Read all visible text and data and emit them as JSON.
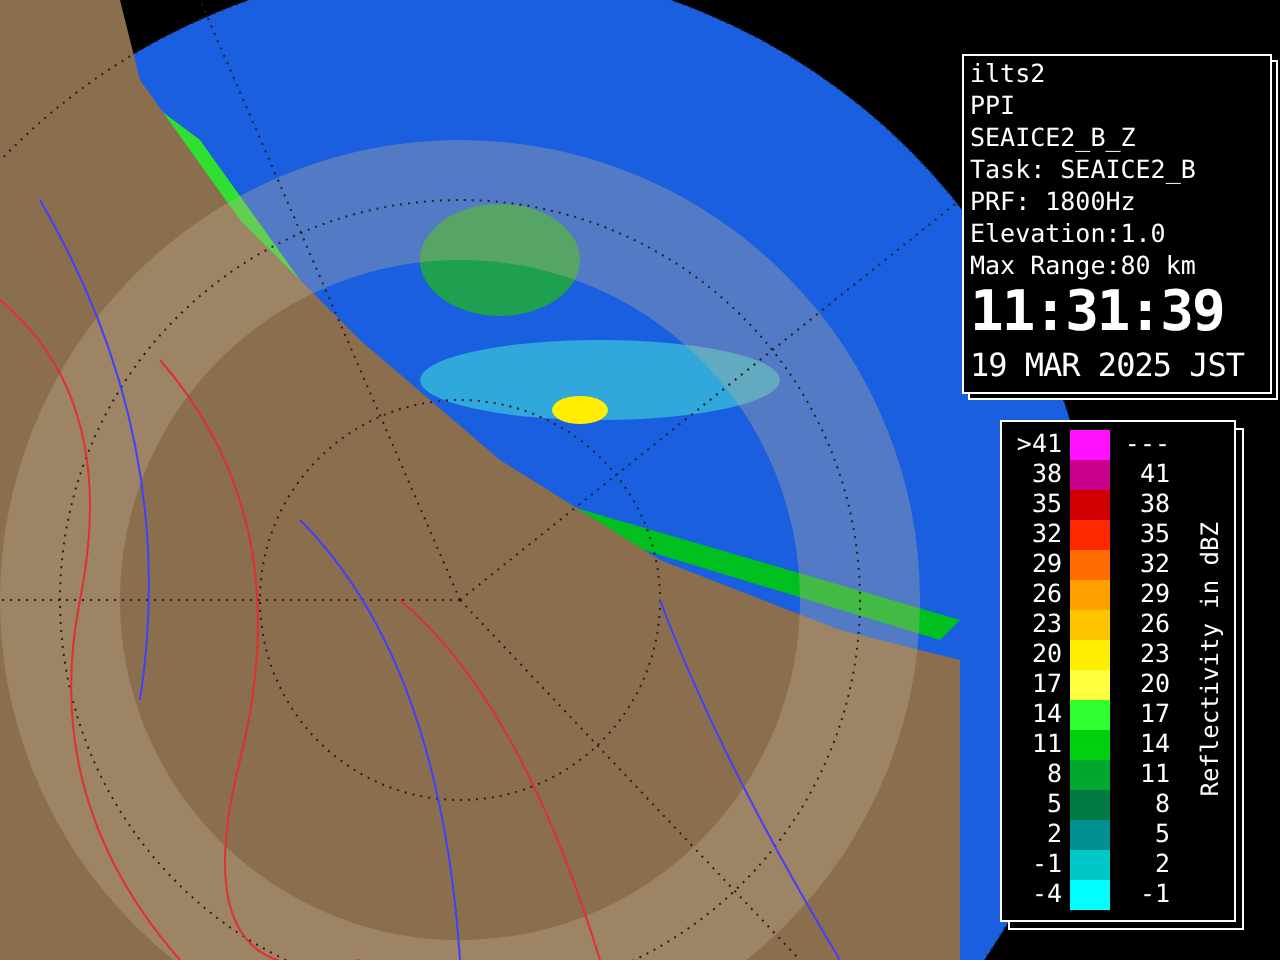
{
  "info_panel": {
    "lines": [
      "ilts2",
      "PPI",
      "SEAICE2_B_Z",
      "Task: SEAICE2_B",
      "PRF: 1800Hz",
      "Elevation:1.0",
      "Max Range:80 km"
    ],
    "time": "11:31:39",
    "date": "19 MAR 2025 JST"
  },
  "legend": {
    "title": "Reflectivity in dBZ",
    "rows": [
      {
        "low": ">41",
        "high": "---",
        "color": "#ff10ff"
      },
      {
        "low": "38",
        "high": "41",
        "color": "#c8008c"
      },
      {
        "low": "35",
        "high": "38",
        "color": "#d00000"
      },
      {
        "low": "32",
        "high": "35",
        "color": "#ff2800"
      },
      {
        "low": "29",
        "high": "32",
        "color": "#ff6c00"
      },
      {
        "low": "26",
        "high": "29",
        "color": "#ffa000"
      },
      {
        "low": "23",
        "high": "26",
        "color": "#ffc400"
      },
      {
        "low": "20",
        "high": "23",
        "color": "#ffee00"
      },
      {
        "low": "17",
        "high": "20",
        "color": "#ffff40"
      },
      {
        "low": "14",
        "high": "17",
        "color": "#30ff30"
      },
      {
        "low": "11",
        "high": "14",
        "color": "#00d010"
      },
      {
        "low": "8",
        "high": "11",
        "color": "#00a830"
      },
      {
        "low": "5",
        "high": "8",
        "color": "#007a40"
      },
      {
        "low": "2",
        "high": "5",
        "color": "#009090"
      },
      {
        "low": "-1",
        "high": "2",
        "color": "#00c8c8"
      },
      {
        "low": "-4",
        "high": "-1",
        "color": "#00ffff"
      }
    ]
  }
}
